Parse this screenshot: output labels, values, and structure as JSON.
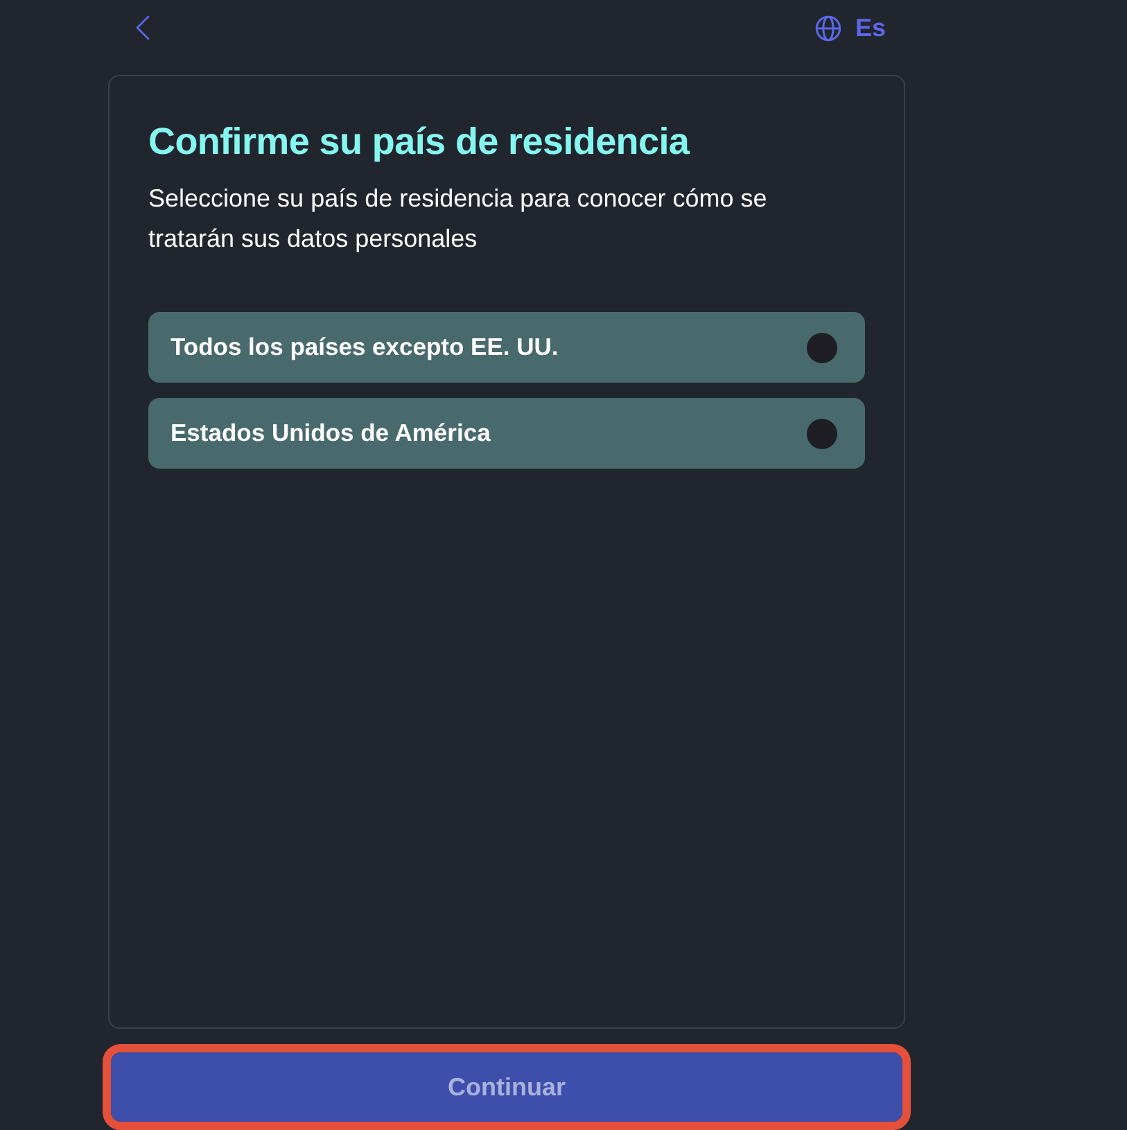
{
  "header": {
    "language": "Es"
  },
  "card": {
    "title": "Confirme su país de residencia",
    "subtitle": "Seleccione su país de residencia para conocer cómo se tratarán sus datos personales",
    "options": [
      {
        "label": "Todos los países excepto EE. UU.",
        "selected": false
      },
      {
        "label": "Estados Unidos de América",
        "selected": false
      }
    ]
  },
  "continue_button": {
    "label": "Continuar",
    "disabled": true,
    "highlighted": true
  }
}
